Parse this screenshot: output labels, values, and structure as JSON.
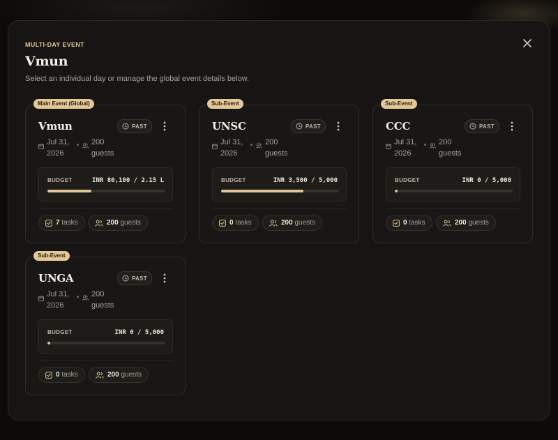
{
  "modal": {
    "eyebrow": "MULTI-DAY EVENT",
    "title": "Vmun",
    "subtitle": "Select an individual day or manage the global event details below.",
    "close_icon": "close-icon"
  },
  "colors": {
    "accent": "#e3c795",
    "background": "#161513"
  },
  "events": [
    {
      "tag": "Main Event (Global)",
      "name": "Vmun",
      "status": "PAST",
      "date_line1": "Jul 31,",
      "date_line2": "2026",
      "guests_line1": "200",
      "guests_line2": "guests",
      "budget_label": "BUDGET",
      "budget_value": "INR 80,100 / 2.15 L",
      "budget_progress_percent": 37,
      "tasks_count": "7",
      "tasks_label": "tasks",
      "guests_count": "200",
      "guests_label": "guests"
    },
    {
      "tag": "Sub-Event",
      "name": "UNSC",
      "status": "PAST",
      "date_line1": "Jul 31,",
      "date_line2": "2026",
      "guests_line1": "200",
      "guests_line2": "guests",
      "budget_label": "BUDGET",
      "budget_value": "INR 3,500 / 5,000",
      "budget_progress_percent": 70,
      "tasks_count": "0",
      "tasks_label": "tasks",
      "guests_count": "200",
      "guests_label": "guests"
    },
    {
      "tag": "Sub-Event",
      "name": "CCC",
      "status": "PAST",
      "date_line1": "Jul 31,",
      "date_line2": "2026",
      "guests_line1": "200",
      "guests_line2": "guests",
      "budget_label": "BUDGET",
      "budget_value": "INR 0 / 5,000",
      "budget_progress_percent": 0,
      "tasks_count": "0",
      "tasks_label": "tasks",
      "guests_count": "200",
      "guests_label": "guests"
    },
    {
      "tag": "Sub-Event",
      "name": "UNGA",
      "status": "PAST",
      "date_line1": "Jul 31,",
      "date_line2": "2026",
      "guests_line1": "200",
      "guests_line2": "guests",
      "budget_label": "BUDGET",
      "budget_value": "INR 0 / 5,000",
      "budget_progress_percent": 0,
      "tasks_count": "0",
      "tasks_label": "tasks",
      "guests_count": "200",
      "guests_label": "guests"
    }
  ]
}
